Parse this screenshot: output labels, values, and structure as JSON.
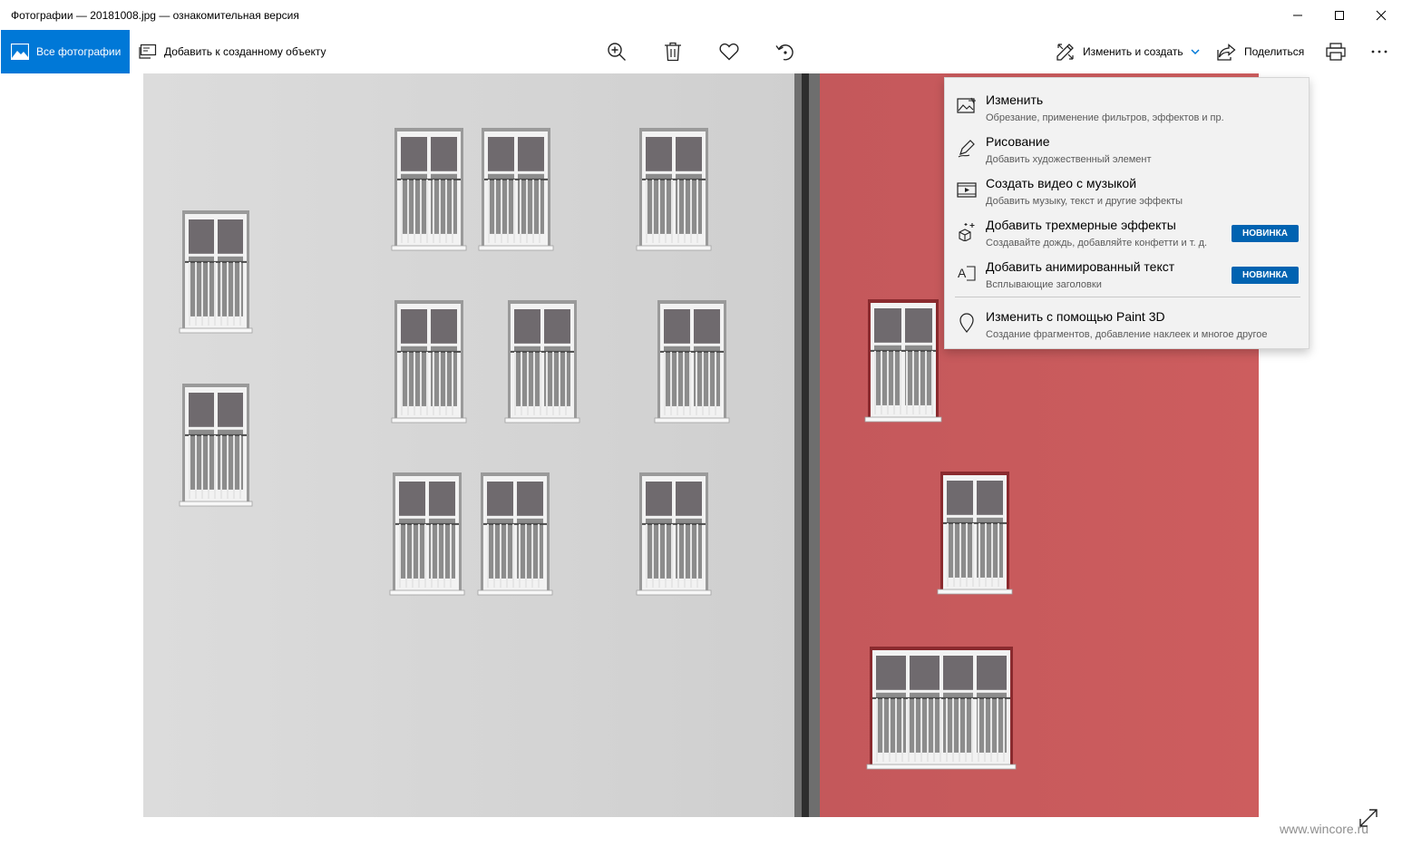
{
  "window": {
    "title": "Фотографии — 20181008.jpg — ознакомительная версия",
    "controls": [
      "minimize-icon",
      "maximize-icon",
      "close-icon"
    ]
  },
  "toolbar": {
    "all_photos_label": "Все фотографии",
    "add_to_creation_label": "Добавить к созданному объекту",
    "icons": [
      "zoom-in-icon",
      "delete-icon",
      "favorite-icon",
      "rotate-icon"
    ],
    "edit_create_label": "Изменить и создать",
    "share_label": "Поделиться",
    "print_icon": "print-icon",
    "more_icon": "more-icon"
  },
  "menu": {
    "items": [
      {
        "title": "Изменить",
        "subtitle": "Обрезание, применение фильтров, эффектов и пр.",
        "icon": "edit-image-icon"
      },
      {
        "title": "Рисование",
        "subtitle": "Добавить художественный элемент",
        "icon": "pen-icon"
      },
      {
        "title": "Создать видео с музыкой",
        "subtitle": "Добавить музыку, текст и другие эффекты",
        "icon": "video-icon"
      },
      {
        "title": "Добавить трехмерные эффекты",
        "subtitle": "Создавайте дождь, добавляйте конфетти и т. д.",
        "icon": "3d-effects-icon",
        "badge": "НОВИНКА"
      },
      {
        "title": "Добавить анимированный текст",
        "subtitle": "Всплывающие заголовки",
        "icon": "animated-text-icon",
        "badge": "НОВИНКА"
      },
      {
        "title": "Изменить с помощью Paint 3D",
        "subtitle": "Создание фрагментов, добавление наклеек и многое другое",
        "icon": "paint3d-icon"
      }
    ]
  },
  "watermark": "www.wincore.ru",
  "colors": {
    "accent": "#0078d7",
    "badge": "#0063b1",
    "wall_left": "#d9d9d9",
    "wall_right": "#c7585a",
    "menu_bg": "#f2f2f2"
  }
}
